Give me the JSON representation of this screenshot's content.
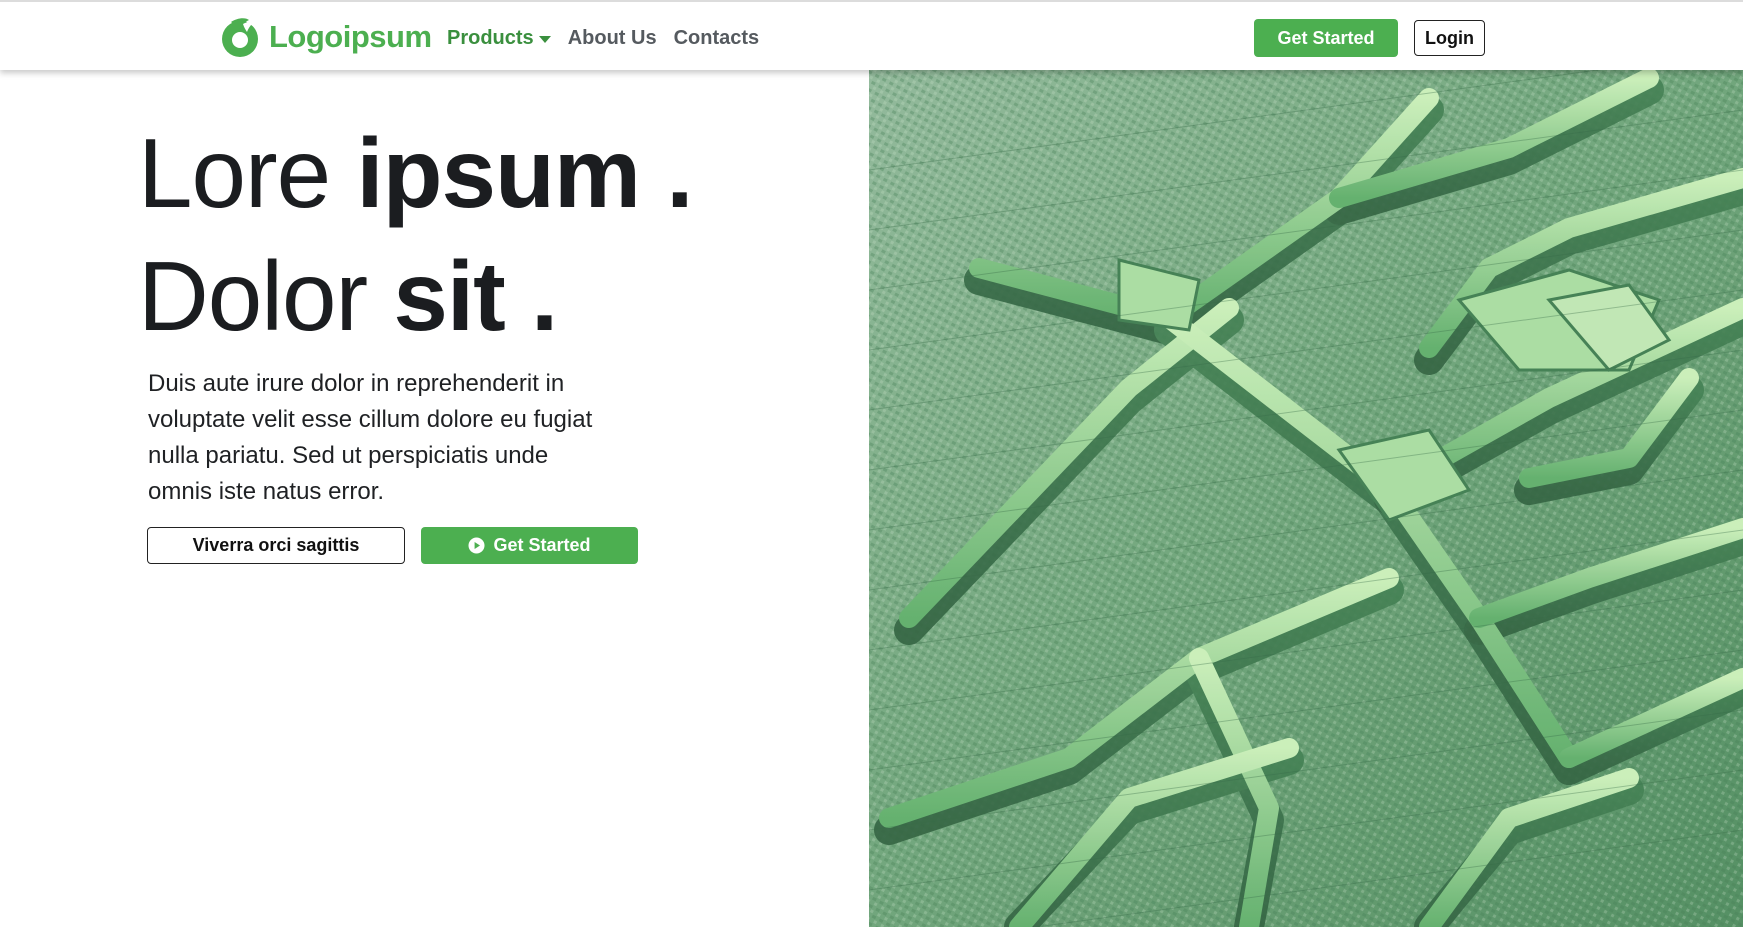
{
  "header": {
    "brand": {
      "name": "Logoipsum",
      "icon": "logo-leaf-icon",
      "color": "#4caf50"
    },
    "nav": [
      {
        "label": "Products",
        "has_dropdown": true,
        "active": true
      },
      {
        "label": "About Us",
        "has_dropdown": false,
        "active": false
      },
      {
        "label": "Contacts",
        "has_dropdown": false,
        "active": false
      }
    ],
    "cta_label": "Get Started",
    "login_label": "Login"
  },
  "hero": {
    "title_line1": {
      "normal": "Lore ",
      "bold": "ipsum",
      "suffix": " ."
    },
    "title_line2": {
      "normal": "Dolor ",
      "bold": "sit",
      "suffix": " ."
    },
    "description": "Duis aute irure dolor in reprehenderit in voluptate velit esse cillum dolore eu fugiat nulla pariatu. Sed ut perspiciatis unde omnis iste natus error.",
    "secondary_button_label": "Viverra orci sagittis",
    "primary_button_label": "Get Started",
    "primary_button_icon": "play-circle-icon"
  },
  "hero_image": {
    "subject": "green voxel maze terrain"
  },
  "colors": {
    "accent": "#4caf50",
    "accent_dark": "#3a8f3e",
    "nav_text": "#555a5f",
    "heading": "#1b1d20"
  }
}
